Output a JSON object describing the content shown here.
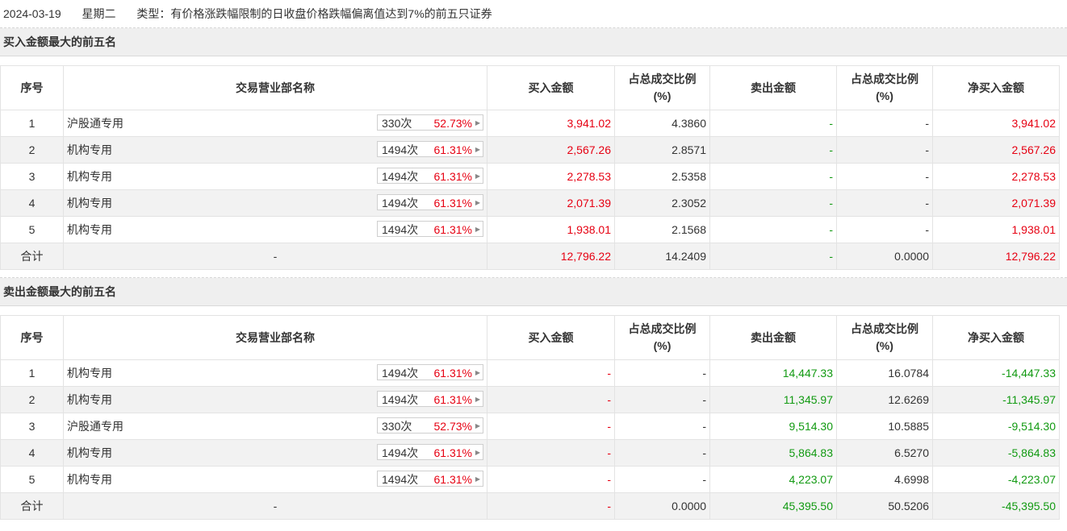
{
  "header": {
    "date": "2024-03-19",
    "weekday": "星期二",
    "type_text": "类型：有价格涨跌幅限制的日收盘价格跌幅偏离值达到7%的前五只证券"
  },
  "columns": [
    "序号",
    "交易营业部名称",
    "买入金额",
    "占总成交比例(%)",
    "卖出金额",
    "占总成交比例(%)",
    "净买入金额"
  ],
  "col_headers": {
    "idx": "序号",
    "name": "交易营业部名称",
    "buy": "买入金额",
    "ratio1_a": "占总成交比例",
    "ratio1_b": "(%)",
    "sell": "卖出金额",
    "ratio2_a": "占总成交比例",
    "ratio2_b": "(%)",
    "net": "净买入金额"
  },
  "buy_section": {
    "title": "买入金额最大的前五名",
    "rows": [
      {
        "idx": "1",
        "name": "沪股通专用",
        "count": "330次",
        "pct": "52.73%",
        "buy": "3,941.02",
        "buy_ratio": "4.3860",
        "sell": "-",
        "sell_ratio": "-",
        "net": "3,941.02"
      },
      {
        "idx": "2",
        "name": "机构专用",
        "count": "1494次",
        "pct": "61.31%",
        "buy": "2,567.26",
        "buy_ratio": "2.8571",
        "sell": "-",
        "sell_ratio": "-",
        "net": "2,567.26"
      },
      {
        "idx": "3",
        "name": "机构专用",
        "count": "1494次",
        "pct": "61.31%",
        "buy": "2,278.53",
        "buy_ratio": "2.5358",
        "sell": "-",
        "sell_ratio": "-",
        "net": "2,278.53"
      },
      {
        "idx": "4",
        "name": "机构专用",
        "count": "1494次",
        "pct": "61.31%",
        "buy": "2,071.39",
        "buy_ratio": "2.3052",
        "sell": "-",
        "sell_ratio": "-",
        "net": "2,071.39"
      },
      {
        "idx": "5",
        "name": "机构专用",
        "count": "1494次",
        "pct": "61.31%",
        "buy": "1,938.01",
        "buy_ratio": "2.1568",
        "sell": "-",
        "sell_ratio": "-",
        "net": "1,938.01"
      }
    ],
    "total": {
      "label": "合计",
      "name": "-",
      "buy": "12,796.22",
      "buy_ratio": "14.2409",
      "sell": "-",
      "sell_ratio": "0.0000",
      "net": "12,796.22"
    }
  },
  "sell_section": {
    "title": "卖出金额最大的前五名",
    "rows": [
      {
        "idx": "1",
        "name": "机构专用",
        "count": "1494次",
        "pct": "61.31%",
        "buy": "-",
        "buy_ratio": "-",
        "sell": "14,447.33",
        "sell_ratio": "16.0784",
        "net": "-14,447.33"
      },
      {
        "idx": "2",
        "name": "机构专用",
        "count": "1494次",
        "pct": "61.31%",
        "buy": "-",
        "buy_ratio": "-",
        "sell": "11,345.97",
        "sell_ratio": "12.6269",
        "net": "-11,345.97"
      },
      {
        "idx": "3",
        "name": "沪股通专用",
        "count": "330次",
        "pct": "52.73%",
        "buy": "-",
        "buy_ratio": "-",
        "sell": "9,514.30",
        "sell_ratio": "10.5885",
        "net": "-9,514.30"
      },
      {
        "idx": "4",
        "name": "机构专用",
        "count": "1494次",
        "pct": "61.31%",
        "buy": "-",
        "buy_ratio": "-",
        "sell": "5,864.83",
        "sell_ratio": "6.5270",
        "net": "-5,864.83"
      },
      {
        "idx": "5",
        "name": "机构专用",
        "count": "1494次",
        "pct": "61.31%",
        "buy": "-",
        "buy_ratio": "-",
        "sell": "4,223.07",
        "sell_ratio": "4.6998",
        "net": "-4,223.07"
      }
    ],
    "total": {
      "label": "合计",
      "name": "-",
      "buy": "-",
      "buy_ratio": "0.0000",
      "sell": "45,395.50",
      "sell_ratio": "50.5206",
      "net": "-45,395.50"
    }
  },
  "colors": {
    "up": "#e60012",
    "down": "#129a12",
    "stripe": "#f2f2f2",
    "section_bg": "#efefef"
  },
  "icons": {
    "row_button_arrow": "caret-right-icon"
  }
}
